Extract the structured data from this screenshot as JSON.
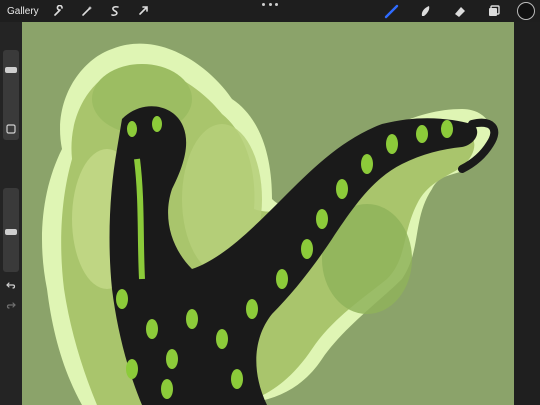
{
  "toolbar": {
    "gallery_label": "Gallery",
    "left_tools": [
      "wrench-icon",
      "magic-wand-icon",
      "selection-icon",
      "transform-arrow-icon"
    ],
    "right_tools": [
      "brush-icon",
      "smudge-icon",
      "eraser-icon",
      "layers-icon"
    ],
    "active_tool": "brush-icon",
    "active_color": "#1a1a1a",
    "accent_color": "#2f6bff"
  },
  "sidebar": {
    "brush_size_level": 0.92,
    "opacity_level": 0.55,
    "buttons": [
      "modify-square-icon",
      "undo-icon",
      "redo-icon"
    ]
  },
  "canvas": {
    "background_color": "#8ba36a",
    "artwork_description_colors": [
      "#cfe79d",
      "#a6c36b",
      "#151515",
      "#8ccb3a"
    ]
  }
}
